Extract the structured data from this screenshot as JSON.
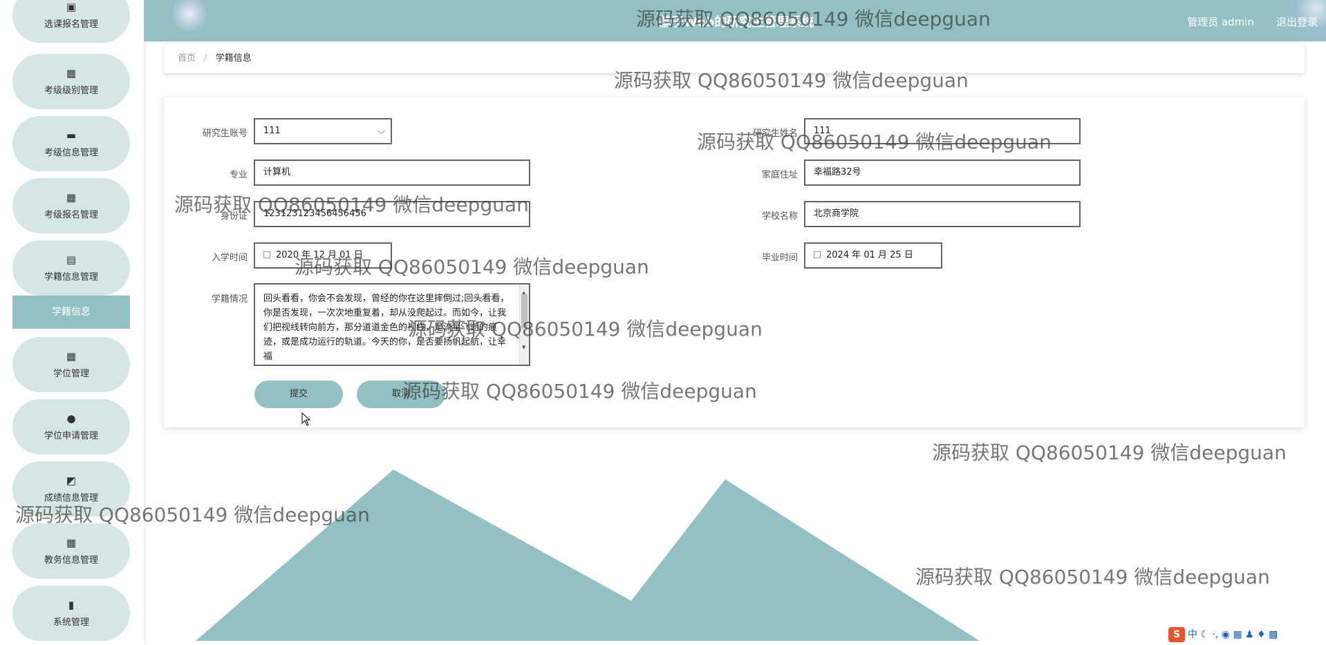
{
  "app": {
    "title": "基于Web的研究生管理系统",
    "user_label": "管理员 admin",
    "logout_label": "退出登录"
  },
  "sidebar": {
    "items": [
      {
        "label": "选课报名管理",
        "icon": "clipboard-icon"
      },
      {
        "label": "考级级别管理",
        "icon": "grid-icon"
      },
      {
        "label": "考级信息管理",
        "icon": "chat-icon"
      },
      {
        "label": "考级报名管理",
        "icon": "grid-icon"
      },
      {
        "label": "学籍信息管理",
        "icon": "document-icon"
      },
      {
        "label": "学位管理",
        "icon": "grid-icon"
      },
      {
        "label": "学位申请管理",
        "icon": "user-icon"
      },
      {
        "label": "成绩信息管理",
        "icon": "chart-line-icon"
      },
      {
        "label": "教务信息管理",
        "icon": "grid-icon"
      },
      {
        "label": "系统管理",
        "icon": "bar-chart-icon"
      }
    ],
    "active_sub": "学籍信息"
  },
  "breadcrumb": {
    "home": "首页",
    "separator": "/",
    "current": "学籍信息"
  },
  "form": {
    "student_account": {
      "label": "研究生账号",
      "value": "111"
    },
    "student_name": {
      "label": "研究生姓名",
      "value": "111"
    },
    "major": {
      "label": "专业",
      "value": "计算机"
    },
    "home_address": {
      "label": "家庭住址",
      "value": "幸福路32号"
    },
    "id_card": {
      "label": "身份证",
      "value": "123123123456456456"
    },
    "school_name": {
      "label": "学校名称",
      "value": "北京商学院"
    },
    "enroll_date": {
      "label": "入学时间",
      "value": "2020 年 12 月 01 日"
    },
    "graduate_date": {
      "label": "毕业时间",
      "value": "2024 年 01 月 25 日"
    },
    "status": {
      "label": "学籍情况",
      "value": "回头看看，你会不会发现，曾经的你在这里摔倒过;回头看看，你是否发现，一次次地重复着，却从没爬起过。而如今，让我们把视线转向前方，那分道道金色的视线，是流星飞逝的痕迹，或是成功运行的轨道。今天的你，是否要扬帆起航，让幸福"
    },
    "submit_label": "提交",
    "cancel_label": "取消"
  },
  "watermark": "源码获取 QQ86050149 微信deepguan",
  "ime": {
    "label": "中"
  },
  "colors": {
    "accent": "#93c1c3",
    "sidebar_pill": "#d6e6e5"
  }
}
